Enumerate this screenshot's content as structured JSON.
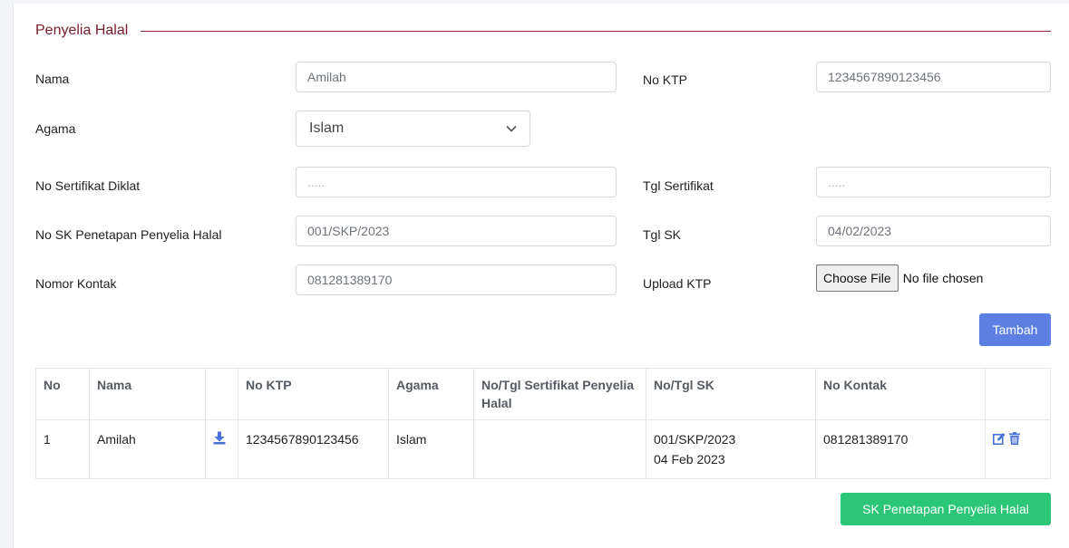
{
  "section": {
    "title": "Penyelia Halal"
  },
  "form": {
    "nama": {
      "label": "Nama",
      "value": "Amilah"
    },
    "no_ktp": {
      "label": "No KTP",
      "value": "1234567890123456"
    },
    "agama": {
      "label": "Agama",
      "value": "Islam"
    },
    "no_sertifikat": {
      "label": "No Sertifikat Diklat",
      "placeholder": "....."
    },
    "tgl_sertifikat": {
      "label": "Tgl Sertifikat",
      "placeholder": "....."
    },
    "no_sk": {
      "label": "No SK Penetapan Penyelia Halal",
      "value": "001/SKP/2023"
    },
    "tgl_sk": {
      "label": "Tgl SK",
      "value": "04/02/2023"
    },
    "kontak": {
      "label": "Nomor Kontak",
      "value": "081281389170"
    },
    "upload_ktp": {
      "label": "Upload KTP",
      "button": "Choose File",
      "status": "No file chosen"
    },
    "tambah": "Tambah"
  },
  "table": {
    "headers": [
      "No",
      "Nama",
      "",
      "No KTP",
      "Agama",
      "No/Tgl Sertifikat Penyelia Halal",
      "No/Tgl SK",
      "No Kontak",
      ""
    ],
    "rows": [
      {
        "no": "1",
        "nama": "Amilah",
        "no_ktp": "1234567890123456",
        "agama": "Islam",
        "sertifikat": "",
        "sk_no": "001/SKP/2023",
        "sk_tgl": "04 Feb 2023",
        "kontak": "081281389170"
      }
    ]
  },
  "footer": {
    "sk_button": "SK Penetapan Penyelia Halal"
  },
  "colors": {
    "legend": "#7b1c2a",
    "primary": "#5b7fe2",
    "success": "#2bc776"
  },
  "icons": {
    "download": "download-icon",
    "edit": "edit-icon",
    "delete": "trash-icon",
    "select": "chevron-down-icon"
  }
}
